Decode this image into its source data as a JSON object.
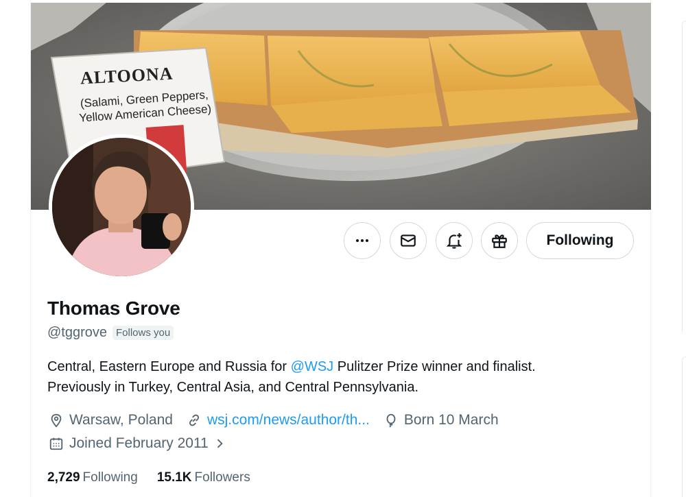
{
  "banner": {
    "sign_title": "ALTOONA",
    "sign_subtitle_line1": "(Salami, Green Peppers,",
    "sign_subtitle_line2": "Yellow American Cheese)"
  },
  "actions": {
    "more_icon": "more-horizontal-icon",
    "message_icon": "envelope-icon",
    "notify_icon": "bell-plus-icon",
    "gift_icon": "gift-icon",
    "follow_label": "Following"
  },
  "profile": {
    "name": "Thomas Grove",
    "handle": "@tggrove",
    "follows_you": "Follows you",
    "bio_prefix": "Central, Eastern Europe and Russia for ",
    "bio_mention": "@WSJ",
    "bio_rest_line1": " Pulitzer Prize winner and finalist.",
    "bio_line2": "Previously in Turkey, Central Asia, and Central Pennsylvania.",
    "location": "Warsaw, Poland",
    "website": "wsj.com/news/author/th...",
    "birthday": "Born 10 March",
    "joined": "Joined February 2011"
  },
  "stats": {
    "following_count": "2,729",
    "following_label": "Following",
    "followers_count": "15.1K",
    "followers_label": "Followers"
  },
  "colors": {
    "accent": "#1d9bf0",
    "muted": "#536471",
    "text": "#0f1419",
    "border": "#cfd9de"
  }
}
